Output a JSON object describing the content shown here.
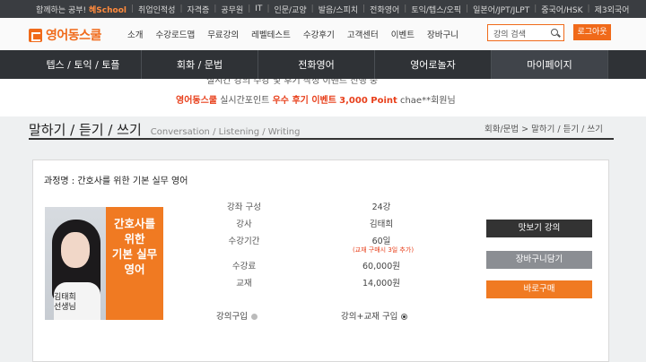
{
  "topbar": {
    "slogan": "함께하는 공부!",
    "brand": "혜School",
    "links": [
      "취업인적성",
      "자격증",
      "공무원",
      "IT",
      "인문/교양",
      "발음/스피치",
      "전화영어",
      "토익/텝스/오픽",
      "일본어/JPT/JLPT",
      "중국어/HSK",
      "제3외국어"
    ]
  },
  "header": {
    "logo": "영어동스쿨",
    "menu": [
      "소개",
      "수강로드맵",
      "무료강의",
      "레벨테스트",
      "수강후기",
      "고객센터",
      "이벤트",
      "장바구니"
    ],
    "search_placeholder": "강의 검색",
    "logout": "로그아웃"
  },
  "mainnav": [
    "텝스 / 토익 / 토플",
    "회화 / 문법",
    "전화영어",
    "영어로놀자",
    "마이페이지"
  ],
  "promo": {
    "cut_line": "실시간 강의 수강 및 후기 작성 이벤트 진행 중",
    "site": "영어동스쿨",
    "text": "실시간포인트",
    "highlight": "우수 후기 이벤트",
    "points": "3,000 Point",
    "winner": "chae**회원님"
  },
  "page": {
    "title": "말하기 / 듣기 / 쓰기",
    "subtitle": "Conversation / Listening / Writing",
    "breadcrumb": "회화/문법 > 말하기 / 듣기 / 쓰기"
  },
  "course": {
    "name_label": "과정명 : 간호사를 위한 기본 실무 영어",
    "banner": [
      "간호사를",
      "위한",
      "기본 실무",
      "영어"
    ],
    "instructor_tag": [
      "김태희",
      "선생님"
    ],
    "rows": [
      {
        "label": "강좌 구성",
        "value": "24강"
      },
      {
        "label": "강사",
        "value": "김태희"
      },
      {
        "label": "수강기간",
        "value": "60일"
      },
      {
        "label": "수강료",
        "value": "60,000원"
      },
      {
        "label": "교재",
        "value": "14,000원"
      }
    ],
    "period_note": "(교재 구매시 3일 추가)",
    "option_lecture": "강의구입",
    "option_bundle": "강의+교재 구입",
    "selected_option": "강의+교재 구입"
  },
  "buttons": {
    "preview": "맛보기 강의",
    "cart": "장바구니담기",
    "buy": "바로구매"
  },
  "colors": {
    "accent": "#f07a22",
    "nav": "#2f3236"
  }
}
